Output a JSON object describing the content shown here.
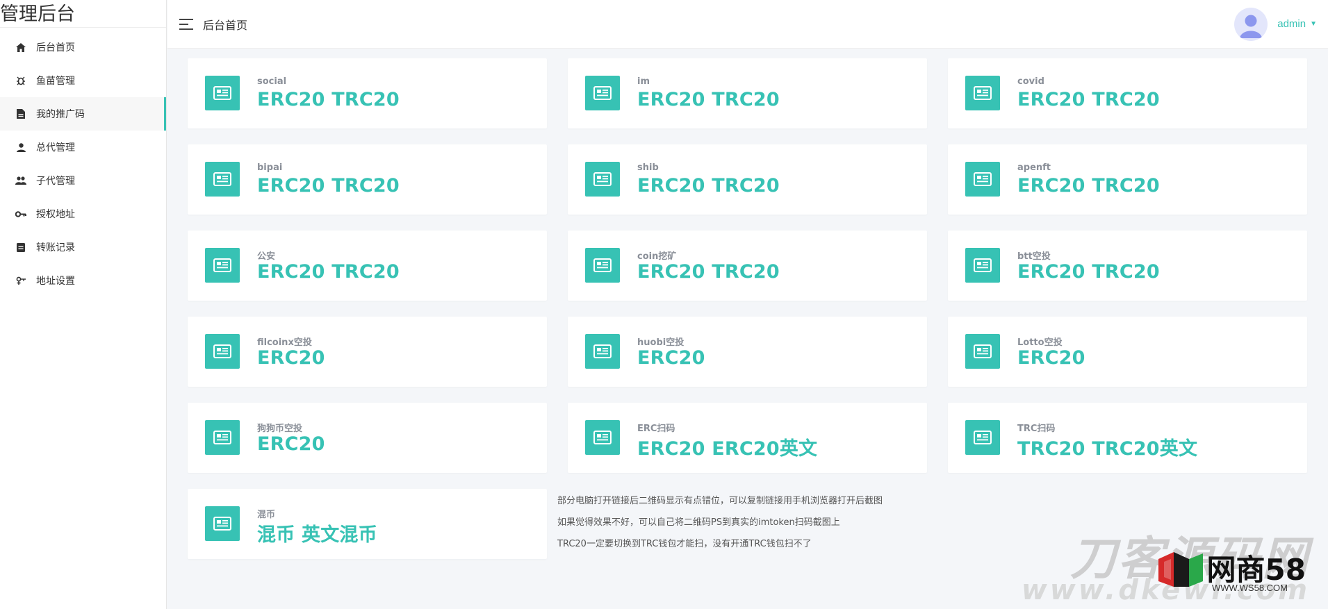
{
  "app": {
    "brand": "管理后台"
  },
  "sidebar": {
    "items": [
      {
        "label": "后台首页",
        "icon": "home-icon"
      },
      {
        "label": "鱼苗管理",
        "icon": "bug-icon"
      },
      {
        "label": "我的推广码",
        "icon": "document-icon",
        "active": true
      },
      {
        "label": "总代管理",
        "icon": "person-icon"
      },
      {
        "label": "子代管理",
        "icon": "people-icon"
      },
      {
        "label": "授权地址",
        "icon": "key-icon"
      },
      {
        "label": "转账记录",
        "icon": "list-icon"
      },
      {
        "label": "地址设置",
        "icon": "settings-icon"
      }
    ]
  },
  "header": {
    "title": "后台首页",
    "user": "admin"
  },
  "cards": [
    {
      "label": "social",
      "value": "ERC20 TRC20"
    },
    {
      "label": "im",
      "value": "ERC20 TRC20"
    },
    {
      "label": "covid",
      "value": "ERC20 TRC20"
    },
    {
      "label": "bipai",
      "value": "ERC20 TRC20"
    },
    {
      "label": "shib",
      "value": "ERC20 TRC20"
    },
    {
      "label": "apenft",
      "value": "ERC20 TRC20"
    },
    {
      "label": "公安",
      "value": "ERC20 TRC20"
    },
    {
      "label": "coin挖矿",
      "value": "ERC20 TRC20"
    },
    {
      "label": "btt空投",
      "value": "ERC20 TRC20"
    },
    {
      "label": "filcoinx空投",
      "value": "ERC20"
    },
    {
      "label": "huobi空投",
      "value": "ERC20"
    },
    {
      "label": "Lotto空投",
      "value": "ERC20"
    },
    {
      "label": "狗狗币空投",
      "value": "ERC20"
    },
    {
      "label": "ERC扫码",
      "value": "ERC20 ERC20英文"
    },
    {
      "label": "TRC扫码",
      "value": "TRC20 TRC20英文"
    },
    {
      "label": "混币",
      "value": "混币 英文混币"
    }
  ],
  "notes": [
    "部分电脑打开链接后二维码显示有点错位，可以复制链接用手机浏览器打开后截图",
    "如果觉得效果不好，可以自己将二维码PS到真实的imtoken扫码截图上",
    "TRC20一定要切换到TRC钱包才能扫，没有开通TRC钱包扫不了"
  ],
  "watermark": {
    "text": "刀客源码网",
    "sub": "www.dkewl.com",
    "logo_text": "网商58",
    "url": "WWW.WS58.COM"
  },
  "colors": {
    "accent": "#37c2b4",
    "background": "#f4f6f9"
  }
}
